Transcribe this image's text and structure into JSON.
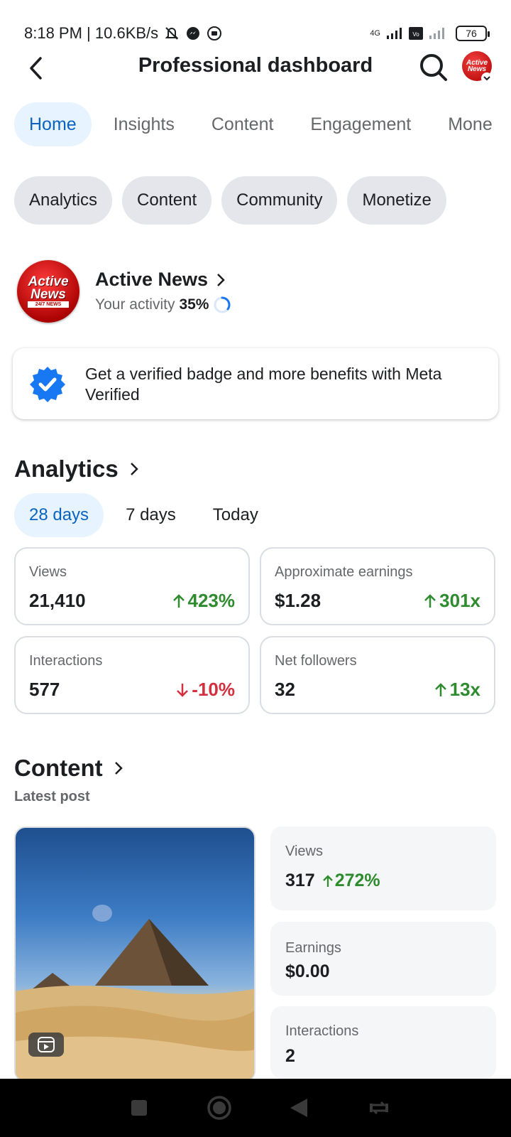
{
  "status_bar": {
    "time_speed": "8:18 PM | 10.6KB/s",
    "network_label": "4G",
    "volte_label": "Vo LTE",
    "battery": "76"
  },
  "header": {
    "title": "Professional dashboard",
    "back_icon": "back-arrow-icon",
    "search_icon": "search-icon",
    "avatar_text": "Active News"
  },
  "tabs": [
    {
      "label": "Home",
      "active": true
    },
    {
      "label": "Insights",
      "active": false
    },
    {
      "label": "Content",
      "active": false
    },
    {
      "label": "Engagement",
      "active": false
    },
    {
      "label": "Mone",
      "active": false
    }
  ],
  "chips": [
    "Analytics",
    "Content",
    "Community",
    "Monetize"
  ],
  "profile": {
    "logo_line1": "Active",
    "logo_line2": "News",
    "logo_line3": "24/7 NEWS",
    "name": "Active News",
    "activity_label": "Your activity",
    "activity_value": "35%",
    "activity_progress": 0.35
  },
  "verified_banner": {
    "text": "Get a verified badge and more benefits with Meta Verified"
  },
  "analytics": {
    "title": "Analytics",
    "periods": [
      {
        "label": "28 days",
        "active": true
      },
      {
        "label": "7 days",
        "active": false
      },
      {
        "label": "Today",
        "active": false
      }
    ],
    "metrics": [
      {
        "label": "Views",
        "value": "21,410",
        "change": "423%",
        "direction": "up"
      },
      {
        "label": "Approximate earnings",
        "value": "$1.28",
        "change": "301x",
        "direction": "up"
      },
      {
        "label": "Interactions",
        "value": "577",
        "change": "-10%",
        "direction": "down"
      },
      {
        "label": "Net followers",
        "value": "32",
        "change": "13x",
        "direction": "up"
      }
    ]
  },
  "content": {
    "title": "Content",
    "subtitle": "Latest post",
    "stats": {
      "views_label": "Views",
      "views_value": "317",
      "views_change": "272%",
      "earnings_label": "Earnings",
      "earnings_value": "$0.00",
      "interactions_label": "Interactions",
      "interactions_value": "2"
    }
  },
  "colors": {
    "accent": "#0b64c0",
    "accent_bg": "#e7f3ff",
    "positive": "#2e8b2e",
    "negative": "#d32f3f",
    "verified": "#1877f2"
  }
}
